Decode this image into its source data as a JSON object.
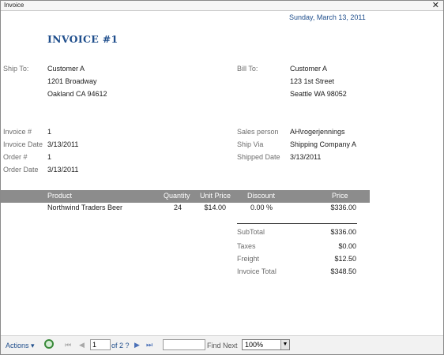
{
  "window": {
    "title": "Invoice",
    "close_label": "✕"
  },
  "report": {
    "date": "Sunday, March 13, 2011",
    "title": "INVOICE #1",
    "ship_to": {
      "label": "Ship To:",
      "name": "Customer A",
      "line1": "1201 Broadway",
      "line2": "Oakland CA  94612"
    },
    "bill_to": {
      "label": "Bill To:",
      "name": "Customer A",
      "line1": "123 1st Street",
      "line2": "Seattle WA  98052"
    },
    "fields_left": [
      {
        "label": "Invoice #",
        "value": "1"
      },
      {
        "label": "Invoice Date",
        "value": "3/13/2011"
      },
      {
        "label": "Order #",
        "value": "1"
      },
      {
        "label": "Order Date",
        "value": "3/13/2011"
      }
    ],
    "fields_right": [
      {
        "label": "Sales person",
        "value": "AH\\rogerjennings"
      },
      {
        "label": "Ship Via",
        "value": "Shipping Company A"
      },
      {
        "label": "Shipped Date",
        "value": "3/13/2011"
      }
    ],
    "table": {
      "headers": {
        "product": "Product",
        "quantity": "Quantity",
        "unit_price": "Unit Price",
        "discount": "Discount",
        "price": "Price"
      },
      "rows": [
        {
          "product": "Northwind Traders Beer",
          "quantity": "24",
          "unit_price": "$14.00",
          "discount": "0.00 %",
          "price": "$336.00"
        }
      ]
    },
    "totals": [
      {
        "label": "SubTotal",
        "value": "$336.00"
      },
      {
        "label": "Taxes",
        "value": "$0.00"
      },
      {
        "label": "Freight",
        "value": "$12.50"
      },
      {
        "label": "Invoice Total",
        "value": "$348.50"
      }
    ]
  },
  "toolbar": {
    "actions_label": "Actions",
    "actions_arrow": "▾",
    "first_icon": "⏮",
    "prev_icon": "◀",
    "page_value": "1",
    "of_pages": "of 2 ?",
    "next_icon": "▶",
    "last_icon": "⏭",
    "find_value": "",
    "find_next_label": "Find Next",
    "zoom_value": "100%",
    "zoom_arrow": "▼"
  },
  "colors": {
    "accent": "#1f4e8c",
    "header_bar": "#8c8c8c"
  }
}
